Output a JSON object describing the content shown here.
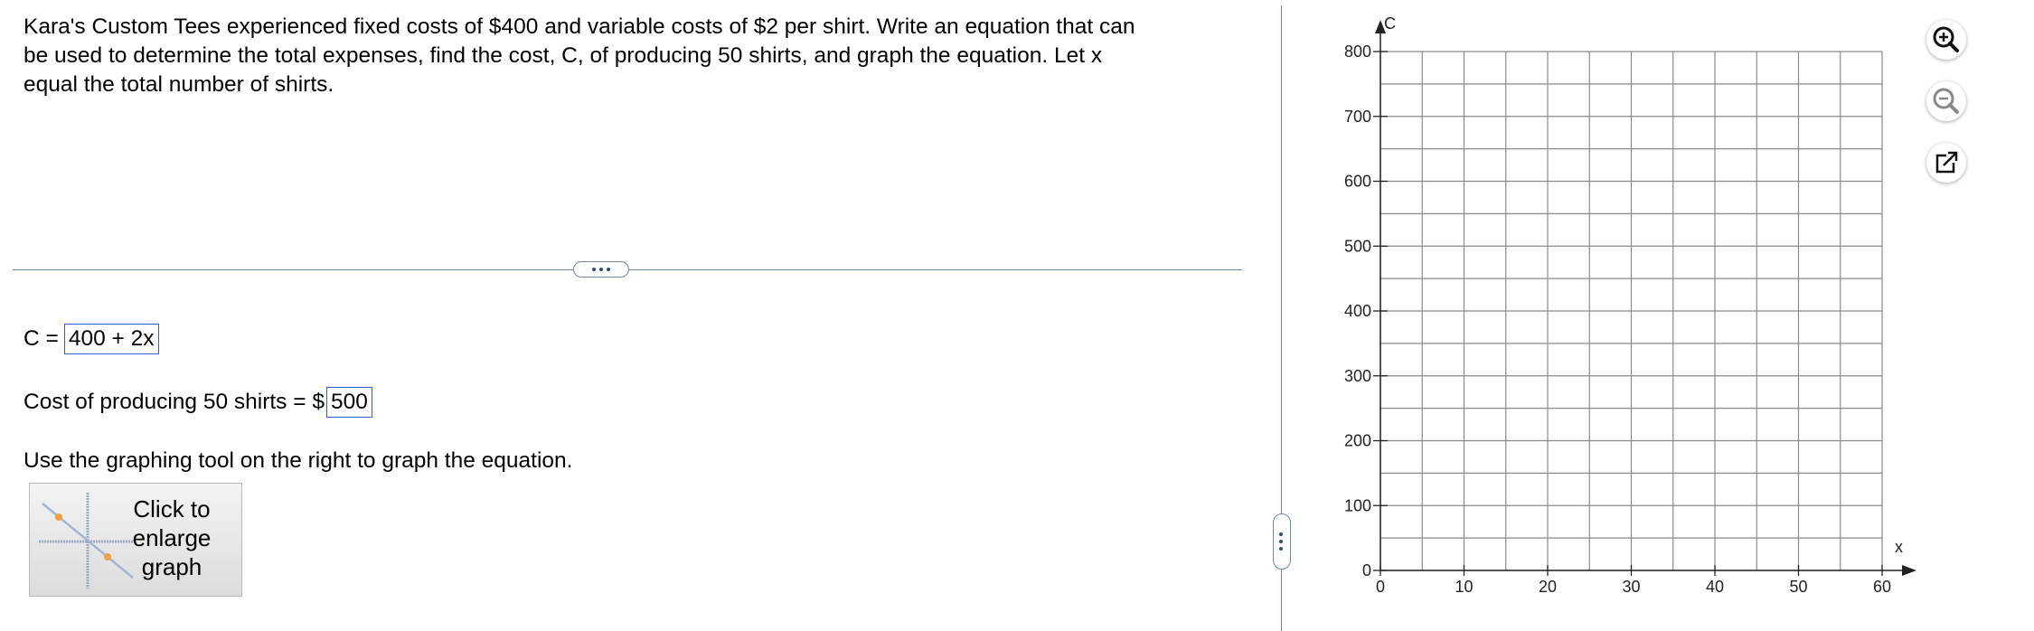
{
  "question": {
    "line1": "Kara's Custom Tees experienced fixed costs of $400 and variable costs of $2 per shirt. Write an equation that can",
    "line2": "be used to determine the total expenses, find the cost, C, of producing 50 shirts, and graph the equation. Let x",
    "line3": "equal the total number of shirts."
  },
  "answers": {
    "equation_label": "C =",
    "equation_value": "400 + 2x",
    "cost_label": "Cost of producing 50 shirts = $",
    "cost_value": "500"
  },
  "instruction": "Use the graphing tool on the right to graph the equation.",
  "enlarge_button": {
    "line1": "Click to",
    "line2": "enlarge",
    "line3": "graph"
  },
  "tools": {
    "zoom_in": "zoom-in-icon",
    "zoom_out": "zoom-out-icon",
    "popout": "external-link-icon"
  },
  "colors": {
    "accent": "#2f5fd1",
    "divider": "#6f86a8",
    "grid": "#888888"
  },
  "chart_data": {
    "type": "scatter",
    "xlabel": "x",
    "ylabel": "C",
    "xlim": [
      0,
      60
    ],
    "ylim": [
      0,
      800
    ],
    "x_ticks": [
      "0",
      "10",
      "20",
      "30",
      "40",
      "50",
      "60"
    ],
    "y_ticks": [
      "0",
      "100",
      "200",
      "300",
      "400",
      "500",
      "600",
      "700",
      "800"
    ],
    "x_minor_step": 5,
    "y_minor_step": 50,
    "grid": true,
    "series": []
  }
}
